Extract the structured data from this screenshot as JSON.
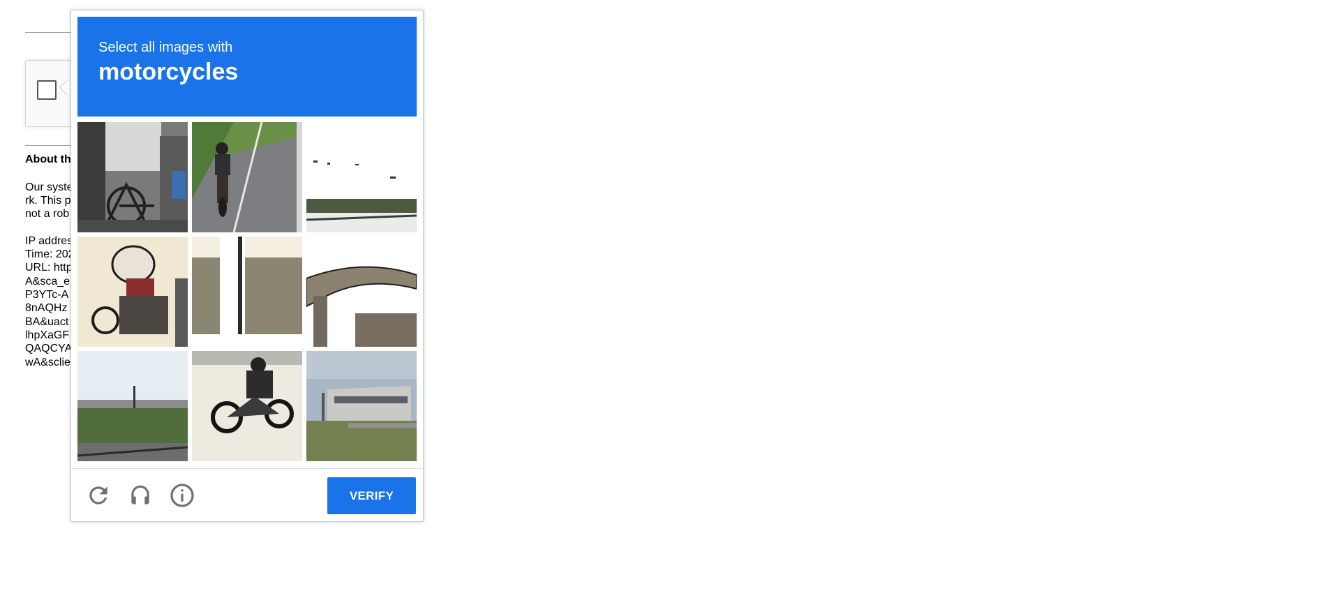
{
  "background": {
    "heading": "About th",
    "paragraph_lines": [
      "Our syste",
      "rk. This p",
      "not a rob"
    ],
    "info_lines": [
      "IP addres",
      "Time: 202",
      "URL: http",
      "A&sca_e",
      "P3YTc-A",
      "8nAQHz",
      "BA&uact",
      "lhpXaGF",
      "QAQCYA",
      "wA&sclie"
    ]
  },
  "challenge": {
    "instruction": "Select all images with",
    "keyword": "motorcycles",
    "tiles": [
      {
        "label": "tile-1",
        "colors": [
          "#6f6f6f",
          "#d9d9d9",
          "#2b2b2b"
        ]
      },
      {
        "label": "tile-2",
        "colors": [
          "#7c7c80",
          "#5f8a43",
          "#3a3a3a"
        ]
      },
      {
        "label": "tile-3",
        "colors": [
          "#ffffff",
          "#e9eef3",
          "#3c4a32"
        ]
      },
      {
        "label": "tile-4",
        "colors": [
          "#f3ead6",
          "#8a2d2b",
          "#2a2a2a"
        ]
      },
      {
        "label": "tile-5",
        "colors": [
          "#f5f0e3",
          "#5c5a4c",
          "#ffffff"
        ]
      },
      {
        "label": "tile-6",
        "colors": [
          "#f7f2ea",
          "#8a8270",
          "#2b2b2b"
        ]
      },
      {
        "label": "tile-7",
        "colors": [
          "#e8eef4",
          "#4d6a3a",
          "#3a3a3a"
        ]
      },
      {
        "label": "tile-8",
        "colors": [
          "#f2eee5",
          "#2a2a2a",
          "#777777"
        ]
      },
      {
        "label": "tile-9",
        "colors": [
          "#a9b7c4",
          "#8d8f8a",
          "#6d7b4a"
        ]
      }
    ],
    "footer": {
      "reload_icon": "reload-icon",
      "audio_icon": "headphones-icon",
      "info_icon": "info-icon",
      "verify_label": "VERIFY"
    },
    "accent_color": "#1a73e8"
  }
}
